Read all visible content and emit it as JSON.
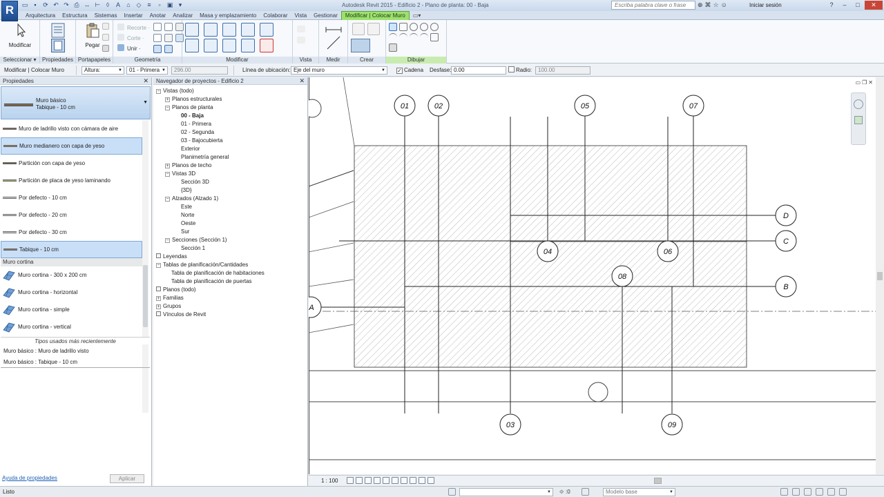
{
  "window": {
    "title": "Autodesk Revit 2015 -    Edificio 2 - Plano de planta: 00 - Baja",
    "search_placeholder": "Escriba palabra clave o frase",
    "signin": "Iniciar sesión",
    "app_letter": "R"
  },
  "ribbon_tabs": [
    "Arquitectura",
    "Estructura",
    "Sistemas",
    "Insertar",
    "Anotar",
    "Analizar",
    "Masa y emplazamiento",
    "Colaborar",
    "Vista",
    "Gestionar",
    "Modificar | Colocar Muro"
  ],
  "ribbon": {
    "panels": {
      "seleccionar": "Seleccionar ▾",
      "propiedades": "Propiedades",
      "portapapeles": "Portapapeles",
      "geometria": "Geometría",
      "modificar": "Modificar",
      "vista": "Vista",
      "medir": "Medir",
      "crear": "Crear",
      "dibujar": "Dibujar"
    },
    "modificar_btn": "Modificar",
    "pegar_btn": "Pegar",
    "recorte": "Recorte ·",
    "corte": "Corte ·",
    "unir": "Unir ·"
  },
  "options_bar": {
    "context": "Modificar | Colocar Muro",
    "altura_label": "Altura:",
    "altura_value": "01 - Primera",
    "height_value": "296.00",
    "linea_label": "Línea de ubicación:",
    "linea_value": "Eje del muro",
    "cadena_label": "Cadena",
    "desfase_label": "Desfase:",
    "desfase_value": "0.00",
    "radio_label": "Radio:",
    "radio_value": "100.00"
  },
  "properties": {
    "title": "Propiedades",
    "type_family": "Muro básico",
    "type_name": "Tabique - 10 cm",
    "types": [
      {
        "name": "Muro de ladrillo visto con cámara de aire",
        "color": "#7a6a5a",
        "selected": false
      },
      {
        "name": "Muro medianero con capa de yeso",
        "color": "#9c7c55",
        "selected": true
      },
      {
        "name": "Partición con capa de yeso",
        "color": "#6b5a48",
        "selected": false
      },
      {
        "name": "Partición de placa de yeso laminando",
        "color": "#a8b45a",
        "selected": false
      },
      {
        "name": "Por defecto - 10 cm",
        "color": "#d8d8d8",
        "selected": false
      },
      {
        "name": "Por defecto - 20 cm",
        "color": "#d8d8d8",
        "selected": false
      },
      {
        "name": "Por defecto - 30 cm",
        "color": "#d8d8d8",
        "selected": false
      },
      {
        "name": "Tabique - 10 cm",
        "color": "#8a7a6a",
        "selected": true
      }
    ],
    "group_curtain": "Muro cortina",
    "curtain_types": [
      "Muro cortina - 300 x 200 cm",
      "Muro cortina - horizontal",
      "Muro cortina - simple",
      "Muro cortina - vertical"
    ],
    "recent_header": "Tipos usados más recientemente",
    "recent": [
      "Muro básico : Muro de ladrillo visto",
      "Muro básico : Tabique - 10 cm"
    ],
    "help_link": "Ayuda de propiedades",
    "apply_btn": "Aplicar"
  },
  "browser": {
    "title": "Navegador de proyectos - Edificio 2",
    "nodes": [
      {
        "label": "Vistas (todo)",
        "depth": 0,
        "toggle": "−",
        "bold": false
      },
      {
        "label": "Planos estructurales",
        "depth": 1,
        "toggle": "+",
        "bold": false
      },
      {
        "label": "Planos de planta",
        "depth": 1,
        "toggle": "−",
        "bold": false
      },
      {
        "label": "00 - Baja",
        "depth": 2,
        "toggle": "",
        "bold": true
      },
      {
        "label": "01 - Primera",
        "depth": 2,
        "toggle": "",
        "bold": false
      },
      {
        "label": "02 - Segunda",
        "depth": 2,
        "toggle": "",
        "bold": false
      },
      {
        "label": "03 - Bajocubierta",
        "depth": 2,
        "toggle": "",
        "bold": false
      },
      {
        "label": "Exterior",
        "depth": 2,
        "toggle": "",
        "bold": false
      },
      {
        "label": "Planimetría general",
        "depth": 2,
        "toggle": "",
        "bold": false
      },
      {
        "label": "Planos de techo",
        "depth": 1,
        "toggle": "+",
        "bold": false
      },
      {
        "label": "Vistas 3D",
        "depth": 1,
        "toggle": "−",
        "bold": false
      },
      {
        "label": "Sección 3D",
        "depth": 2,
        "toggle": "",
        "bold": false
      },
      {
        "label": "{3D}",
        "depth": 2,
        "toggle": "",
        "bold": false
      },
      {
        "label": "Alzados (Alzado 1)",
        "depth": 1,
        "toggle": "−",
        "bold": false
      },
      {
        "label": "Este",
        "depth": 2,
        "toggle": "",
        "bold": false
      },
      {
        "label": "Norte",
        "depth": 2,
        "toggle": "",
        "bold": false
      },
      {
        "label": "Oeste",
        "depth": 2,
        "toggle": "",
        "bold": false
      },
      {
        "label": "Sur",
        "depth": 2,
        "toggle": "",
        "bold": false
      },
      {
        "label": "Secciones (Sección 1)",
        "depth": 1,
        "toggle": "−",
        "bold": false
      },
      {
        "label": "Sección 1",
        "depth": 2,
        "toggle": "",
        "bold": false
      },
      {
        "label": "Leyendas",
        "depth": 0,
        "toggle": "",
        "bold": false
      },
      {
        "label": "Tablas de planificación/Cantidades",
        "depth": 0,
        "toggle": "−",
        "bold": false
      },
      {
        "label": "Tabla de planificación de habitaciones",
        "depth": 1,
        "toggle": "",
        "bold": false
      },
      {
        "label": "Tabla de planificación de puertas",
        "depth": 1,
        "toggle": "",
        "bold": false
      },
      {
        "label": "Planos (todo)",
        "depth": 0,
        "toggle": "",
        "bold": false
      },
      {
        "label": "Familias",
        "depth": 0,
        "toggle": "+",
        "bold": false
      },
      {
        "label": "Grupos",
        "depth": 0,
        "toggle": "+",
        "bold": false
      },
      {
        "label": "Vínculos de Revit",
        "depth": 0,
        "toggle": "",
        "bold": false
      }
    ]
  },
  "canvas": {
    "grid_bubbles_top": [
      "01",
      "02",
      "05",
      "07"
    ],
    "grid_bubbles_mid": [
      "04",
      "06",
      "08"
    ],
    "grid_bubbles_bottom": [
      "03",
      "09"
    ],
    "grid_bubbles_right": [
      "D",
      "C",
      "B"
    ],
    "grid_bubble_left": "A"
  },
  "view_bar": {
    "scale": "1 : 100"
  },
  "status_bar": {
    "text": "Listo",
    "selection_count": ":0",
    "model": "Modelo base"
  }
}
